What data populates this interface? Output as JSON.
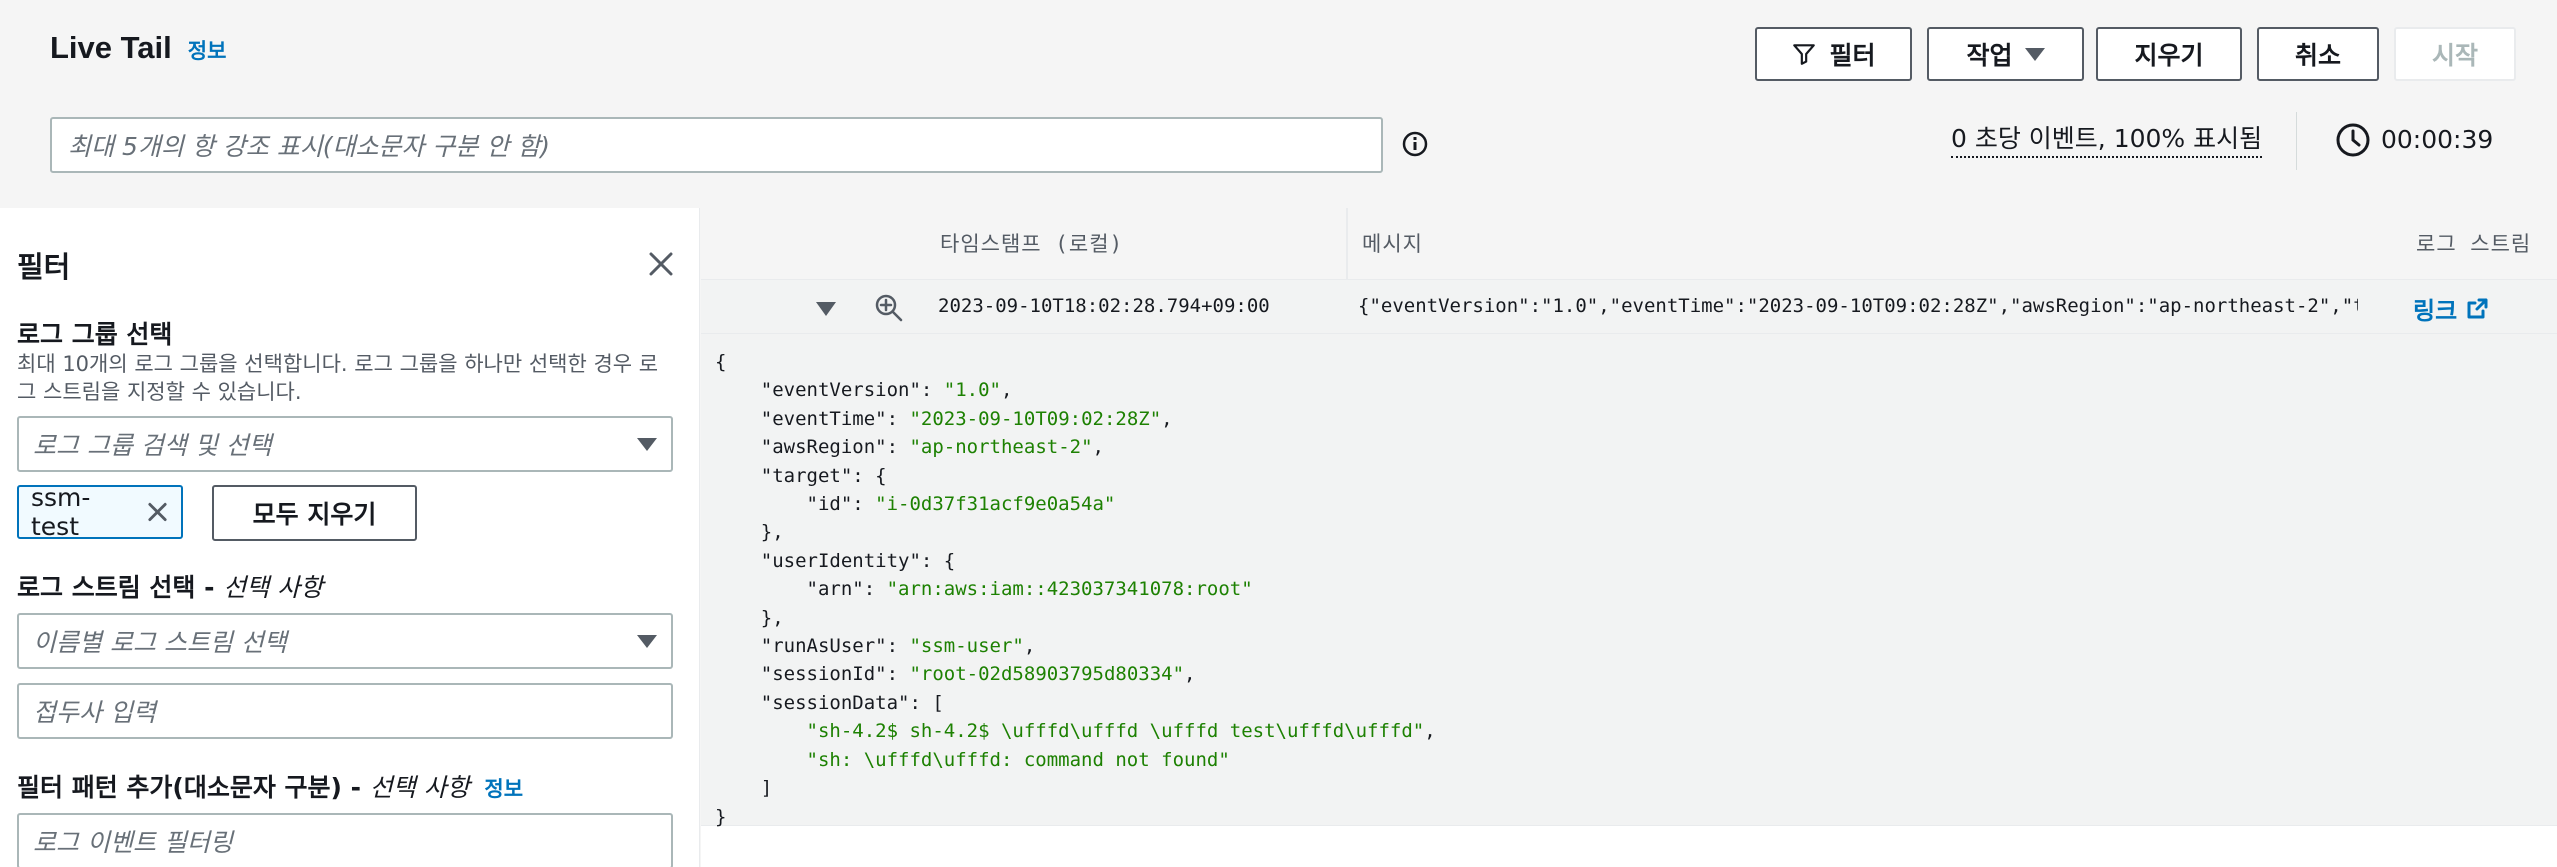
{
  "header": {
    "title": "Live Tail",
    "info": "정보",
    "buttons": {
      "filter": "필터",
      "actions": "작업",
      "clear": "지우기",
      "cancel": "취소",
      "start": "시작"
    },
    "highlight_placeholder": "최대 5개의 항 강조 표시(대소문자 구분 안 함)",
    "rate": "0 초당 이벤트, 100% 표시됨",
    "timer": "00:00:39"
  },
  "filter_panel": {
    "title": "필터",
    "log_group": {
      "label": "로그 그룹 선택",
      "description": "최대 10개의 로그 그룹을 선택합니다. 로그 그룹을 하나만 선택한 경우 로그 스트림을 지정할 수 있습니다.",
      "placeholder": "로그 그룹 검색 및 선택",
      "selected_token": "ssm-test",
      "clear_all": "모두 지우기"
    },
    "log_stream": {
      "label": "로그 스트림 선택 - ",
      "label_optional": "선택 사항",
      "placeholder": "이름별 로그 스트림 선택",
      "prefix_placeholder": "접두사 입력"
    },
    "filter_pattern": {
      "label": "필터 패턴 추가(대소문자 구분) - ",
      "label_optional": "선택 사항",
      "info": "정보",
      "placeholder": "로그 이벤트 필터링"
    }
  },
  "table": {
    "columns": {
      "timestamp": "타임스탬프 (로컬)",
      "message": "메시지",
      "log_stream": "로그 스트림"
    },
    "row": {
      "timestamp": "2023-09-10T18:02:28.794+09:00",
      "message": "{\"eventVersion\":\"1.0\",\"eventTime\":\"2023-09-10T09:02:28Z\",\"awsRegion\":\"ap-northeast-2\",\"t…",
      "link": "링크"
    },
    "json_lines": [
      {
        "indent": 0,
        "key": "",
        "value": "",
        "text": "{"
      },
      {
        "indent": 1,
        "key": "\"eventVersion\": ",
        "value": "\"1.0\"",
        "text": ","
      },
      {
        "indent": 1,
        "key": "\"eventTime\": ",
        "value": "\"2023-09-10T09:02:28Z\"",
        "text": ","
      },
      {
        "indent": 1,
        "key": "\"awsRegion\": ",
        "value": "\"ap-northeast-2\"",
        "text": ","
      },
      {
        "indent": 1,
        "key": "\"target\": ",
        "value": "",
        "text": "{"
      },
      {
        "indent": 2,
        "key": "\"id\": ",
        "value": "\"i-0d37f31acf9e0a54a\"",
        "text": ""
      },
      {
        "indent": 1,
        "key": "",
        "value": "",
        "text": "},"
      },
      {
        "indent": 1,
        "key": "\"userIdentity\": ",
        "value": "",
        "text": "{"
      },
      {
        "indent": 2,
        "key": "\"arn\": ",
        "value": "\"arn:aws:iam::423037341078:root\"",
        "text": ""
      },
      {
        "indent": 1,
        "key": "",
        "value": "",
        "text": "},"
      },
      {
        "indent": 1,
        "key": "\"runAsUser\": ",
        "value": "\"ssm-user\"",
        "text": ","
      },
      {
        "indent": 1,
        "key": "\"sessionId\": ",
        "value": "\"root-02d58903795d80334\"",
        "text": ","
      },
      {
        "indent": 1,
        "key": "\"sessionData\": ",
        "value": "",
        "text": "["
      },
      {
        "indent": 2,
        "key": "",
        "value": "\"sh-4.2$ sh-4.2$ \\ufffd\\ufffd \\ufffd test\\ufffd\\ufffd\"",
        "text": ","
      },
      {
        "indent": 2,
        "key": "",
        "value": "\"sh: \\ufffd\\ufffd: command not found\"",
        "text": ""
      },
      {
        "indent": 1,
        "key": "",
        "value": "",
        "text": "]"
      },
      {
        "indent": 0,
        "key": "",
        "value": "",
        "text": "}"
      }
    ]
  }
}
